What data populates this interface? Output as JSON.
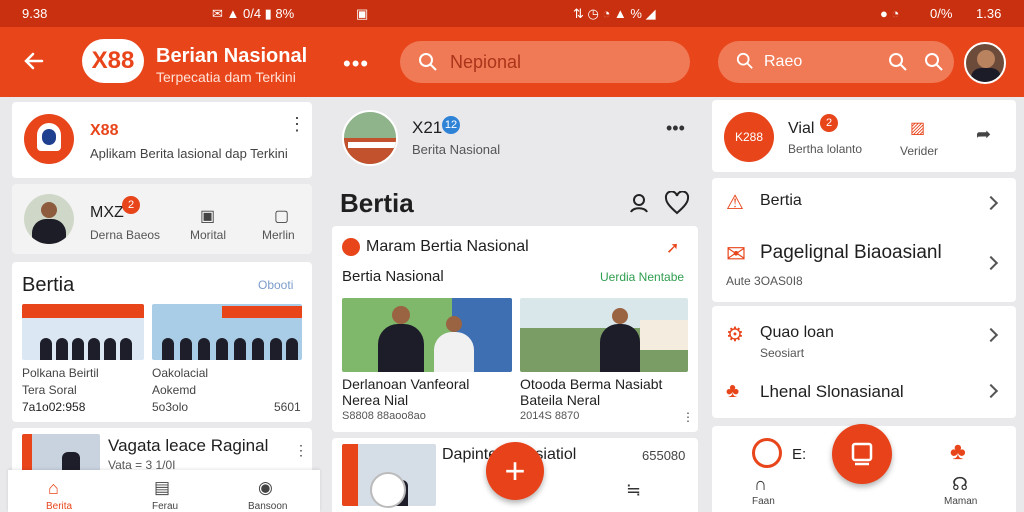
{
  "status": {
    "left_time": "9.38",
    "right_time": "1.36",
    "battery_pct": "0/%"
  },
  "appbar": {
    "logo_text": "X88",
    "title": "Berian Nasional",
    "subtitle": "Terpecatia dam Terkini",
    "search1_placeholder": "Nepional",
    "search2_placeholder": "Raeo"
  },
  "left": {
    "profile_name": "X88",
    "profile_desc": "Aplikam Berita lasional dap Terkini",
    "user_name": "MXZ",
    "user_badge": "2",
    "user_sub": "Derna Baeos",
    "action1": "Morital",
    "action2": "Merlin",
    "section_title": "Bertia",
    "section_link": "Obooti",
    "news1_title": "Polkana Beirtil",
    "news1_sub": "Tera Soral",
    "news1_meta": "7a1o02:958",
    "news2_title": "Oakolacial",
    "news2_sub": "Aokemd",
    "news2_meta": "5o3olo",
    "news2_count": "5601",
    "list_title": "Vagata leace Raginal",
    "list_meta": "Vata = 3 1/0I",
    "nav": [
      "Berita",
      "Ferau",
      "Bansoon"
    ]
  },
  "mid": {
    "source_name": "X21",
    "source_badge": "12",
    "source_desc": "Berita Nasional",
    "heading": "Bertia",
    "card_title": "Maram Bertia Nasional",
    "card_sub": "Bertia Nasional",
    "card_tag": "Uerdia Nentabe",
    "story1_title": "Derlanoan Vanfeoral",
    "story1_sub": "Nerea Nial",
    "story1_meta": "S8808 88aoo8ao",
    "story2_title": "Otooda Berma Nasiabt",
    "story2_sub": "Bateila Neral",
    "story2_meta": "2014S 8870",
    "bottom_title": "Dapinteo: Nasiatiol",
    "bottom_count": "655080",
    "fab": "+"
  },
  "right": {
    "profile_logo": "K288",
    "profile_name": "Vial",
    "profile_badge": "2",
    "profile_sub": "Bertha lolanto",
    "profile_action": "Verider",
    "row1_title": "Bertia",
    "row2_title": "Pagelignal Biaoasianl",
    "row2_meta": "Aute  3OAS0I8",
    "row3_title": "Quao loan",
    "row3_sub": "Seosiart",
    "row4_title": "Lhenal Slonasianal",
    "partial_text": "E:",
    "nav": [
      "Faan",
      "Maman"
    ]
  }
}
